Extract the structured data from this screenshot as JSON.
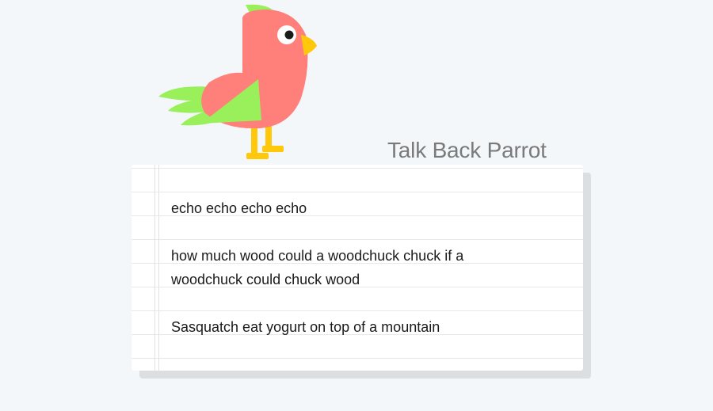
{
  "app": {
    "title": "Talk Back Parrot"
  },
  "messages": [
    "echo echo echo echo",
    "how much wood could a woodchuck chuck if a woodchuck could chuck wood",
    "Sasquatch eat yogurt on top of a mountain"
  ],
  "colors": {
    "background": "#f4f7fa",
    "parrot_body": "#ff7f7a",
    "parrot_wing": "#99f05a",
    "parrot_beak_legs": "#ffc80a",
    "title_text": "#7a7a7a"
  },
  "icons": {
    "mascot": "parrot-icon"
  }
}
